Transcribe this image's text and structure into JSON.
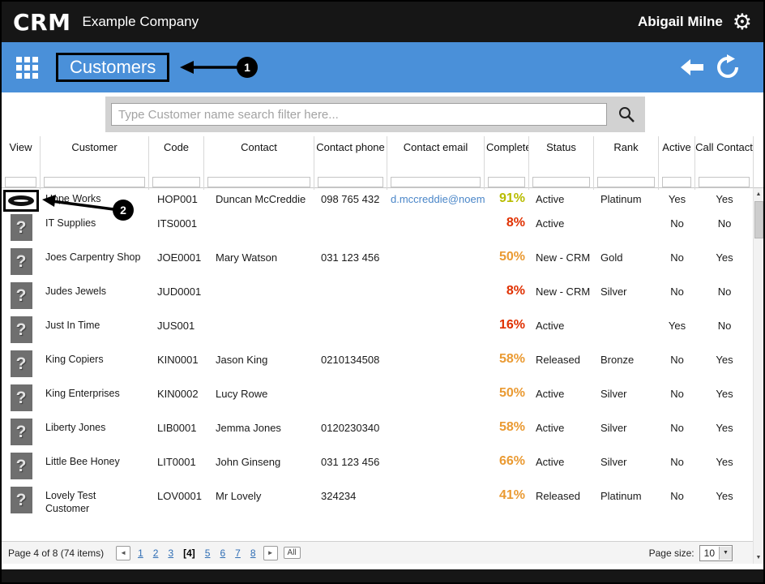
{
  "topbar": {
    "logo": "CRM",
    "company": "Example Company",
    "user": "Abigail Milne"
  },
  "nav": {
    "title": "Customers"
  },
  "callouts": {
    "one": "1",
    "two": "2"
  },
  "search": {
    "placeholder": "Type Customer name search filter here..."
  },
  "table": {
    "columns": [
      "View",
      "Customer",
      "Code",
      "Contact",
      "Contact phone",
      "Contact email",
      "Complete",
      "Status",
      "Rank",
      "Active",
      "Call Contact"
    ],
    "rows": [
      {
        "icon": "hope-works-logo",
        "customer": "Hope Works",
        "code": "HOP001",
        "contact": "Duncan McCreddie",
        "phone": "098 765 432",
        "email": "d.mccreddie@noem",
        "complete": "91%",
        "complete_color": "#b8bc00",
        "status": "Active",
        "rank": "Platinum",
        "active": "Yes",
        "call_contact": "Yes"
      },
      {
        "icon": "question-placeholder",
        "customer": "IT Supplies",
        "code": "ITS0001",
        "contact": "",
        "phone": "",
        "email": "",
        "complete": "8%",
        "complete_color": "#e03000",
        "status": "Active",
        "rank": "",
        "active": "No",
        "call_contact": "No"
      },
      {
        "icon": "question-placeholder",
        "customer": "Joes Carpentry Shop",
        "code": "JOE0001",
        "contact": "Mary Watson",
        "phone": "031 123 456",
        "email": "",
        "complete": "50%",
        "complete_color": "#ea9a32",
        "status": "New - CRM",
        "rank": "Gold",
        "active": "No",
        "call_contact": "Yes"
      },
      {
        "icon": "question-placeholder",
        "customer": "Judes Jewels",
        "code": "JUD0001",
        "contact": "",
        "phone": "",
        "email": "",
        "complete": "8%",
        "complete_color": "#e03000",
        "status": "New - CRM",
        "rank": "Silver",
        "active": "No",
        "call_contact": "No"
      },
      {
        "icon": "question-placeholder",
        "customer": "Just In Time",
        "code": "JUS001",
        "contact": "",
        "phone": "",
        "email": "",
        "complete": "16%",
        "complete_color": "#e03000",
        "status": "Active",
        "rank": "",
        "active": "Yes",
        "call_contact": "No"
      },
      {
        "icon": "question-placeholder",
        "customer": "King Copiers",
        "code": "KIN0001",
        "contact": "Jason King",
        "phone": "0210134508",
        "email": "",
        "complete": "58%",
        "complete_color": "#ea9a32",
        "status": "Released",
        "rank": "Bronze",
        "active": "No",
        "call_contact": "Yes"
      },
      {
        "icon": "question-placeholder",
        "customer": "King Enterprises",
        "code": "KIN0002",
        "contact": "Lucy Rowe",
        "phone": "",
        "email": "",
        "complete": "50%",
        "complete_color": "#ea9a32",
        "status": "Active",
        "rank": "Silver",
        "active": "No",
        "call_contact": "Yes"
      },
      {
        "icon": "question-placeholder",
        "customer": "Liberty Jones",
        "code": "LIB0001",
        "contact": "Jemma Jones",
        "phone": "0120230340",
        "email": "",
        "complete": "58%",
        "complete_color": "#ea9a32",
        "status": "Active",
        "rank": "Silver",
        "active": "No",
        "call_contact": "Yes"
      },
      {
        "icon": "question-placeholder",
        "customer": "Little Bee Honey",
        "code": "LIT0001",
        "contact": "John Ginseng",
        "phone": "031 123 456",
        "email": "",
        "complete": "66%",
        "complete_color": "#ea9a32",
        "status": "Active",
        "rank": "Silver",
        "active": "No",
        "call_contact": "Yes"
      },
      {
        "icon": "question-placeholder",
        "customer": "Lovely Test Customer",
        "code": "LOV0001",
        "contact": "Mr Lovely",
        "phone": "324234",
        "email": "",
        "complete": "41%",
        "complete_color": "#ea9a32",
        "status": "Released",
        "rank": "Platinum",
        "active": "No",
        "call_contact": "Yes"
      }
    ]
  },
  "pagination": {
    "summary": "Page 4 of 8 (74 items)",
    "prev": "◄",
    "pages": [
      "1",
      "2",
      "3",
      "[4]",
      "5",
      "6",
      "7",
      "8"
    ],
    "current_page": "[4]",
    "next": "►",
    "all": "All",
    "page_size_label": "Page size:",
    "page_size": "10"
  },
  "colors": {
    "topbar": "#161616",
    "nav_blue": "#4a90d9",
    "link": "#2e6db4",
    "email_link": "#4a86c8",
    "percent_red": "#e03000",
    "percent_orange": "#ea9a32",
    "percent_yellow_green": "#b8bc00"
  }
}
